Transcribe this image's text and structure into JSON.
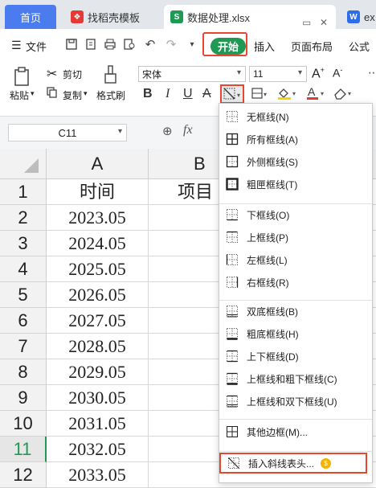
{
  "tabs": {
    "home": "首页",
    "template": "找稻壳模板",
    "file": "数据处理.xlsx",
    "other": "ex"
  },
  "menu": {
    "file": "文件",
    "start": "开始",
    "insert": "插入",
    "page_layout": "页面布局",
    "formula": "公式"
  },
  "toolbar": {
    "paste": "粘贴",
    "cut": "剪切",
    "copy": "复制",
    "format_painter": "格式刷",
    "font_name": "宋体",
    "font_size": "11",
    "bold": "B",
    "italic": "I",
    "underline": "U",
    "strike": "A"
  },
  "formula_bar": {
    "cell_ref": "C11",
    "fx": "fx"
  },
  "grid": {
    "columns": [
      "A",
      "B"
    ],
    "header_row": {
      "a": "时间",
      "b": "项目"
    },
    "rows": [
      "1",
      "2",
      "3",
      "4",
      "5",
      "6",
      "7",
      "8",
      "9",
      "10",
      "11",
      "12"
    ],
    "dates": [
      "2023.05",
      "2024.05",
      "2025.05",
      "2026.05",
      "2027.05",
      "2028.05",
      "2029.05",
      "2030.05",
      "2031.05",
      "2032.05",
      "2033.05"
    ],
    "active_row": "11"
  },
  "border_menu": {
    "items": [
      "无框线(N)",
      "所有框线(A)",
      "外侧框线(S)",
      "粗匣框线(T)",
      "下框线(O)",
      "上框线(P)",
      "左框线(L)",
      "右框线(R)",
      "双底框线(B)",
      "粗底框线(H)",
      "上下框线(D)",
      "上框线和粗下框线(C)",
      "上框线和双下框线(U)",
      "其他边框(M)...",
      "插入斜线表头..."
    ]
  },
  "colors": {
    "accent_green": "#1f9a55",
    "highlight_red": "#e8462f",
    "home_tab_blue": "#4a7cf0"
  }
}
